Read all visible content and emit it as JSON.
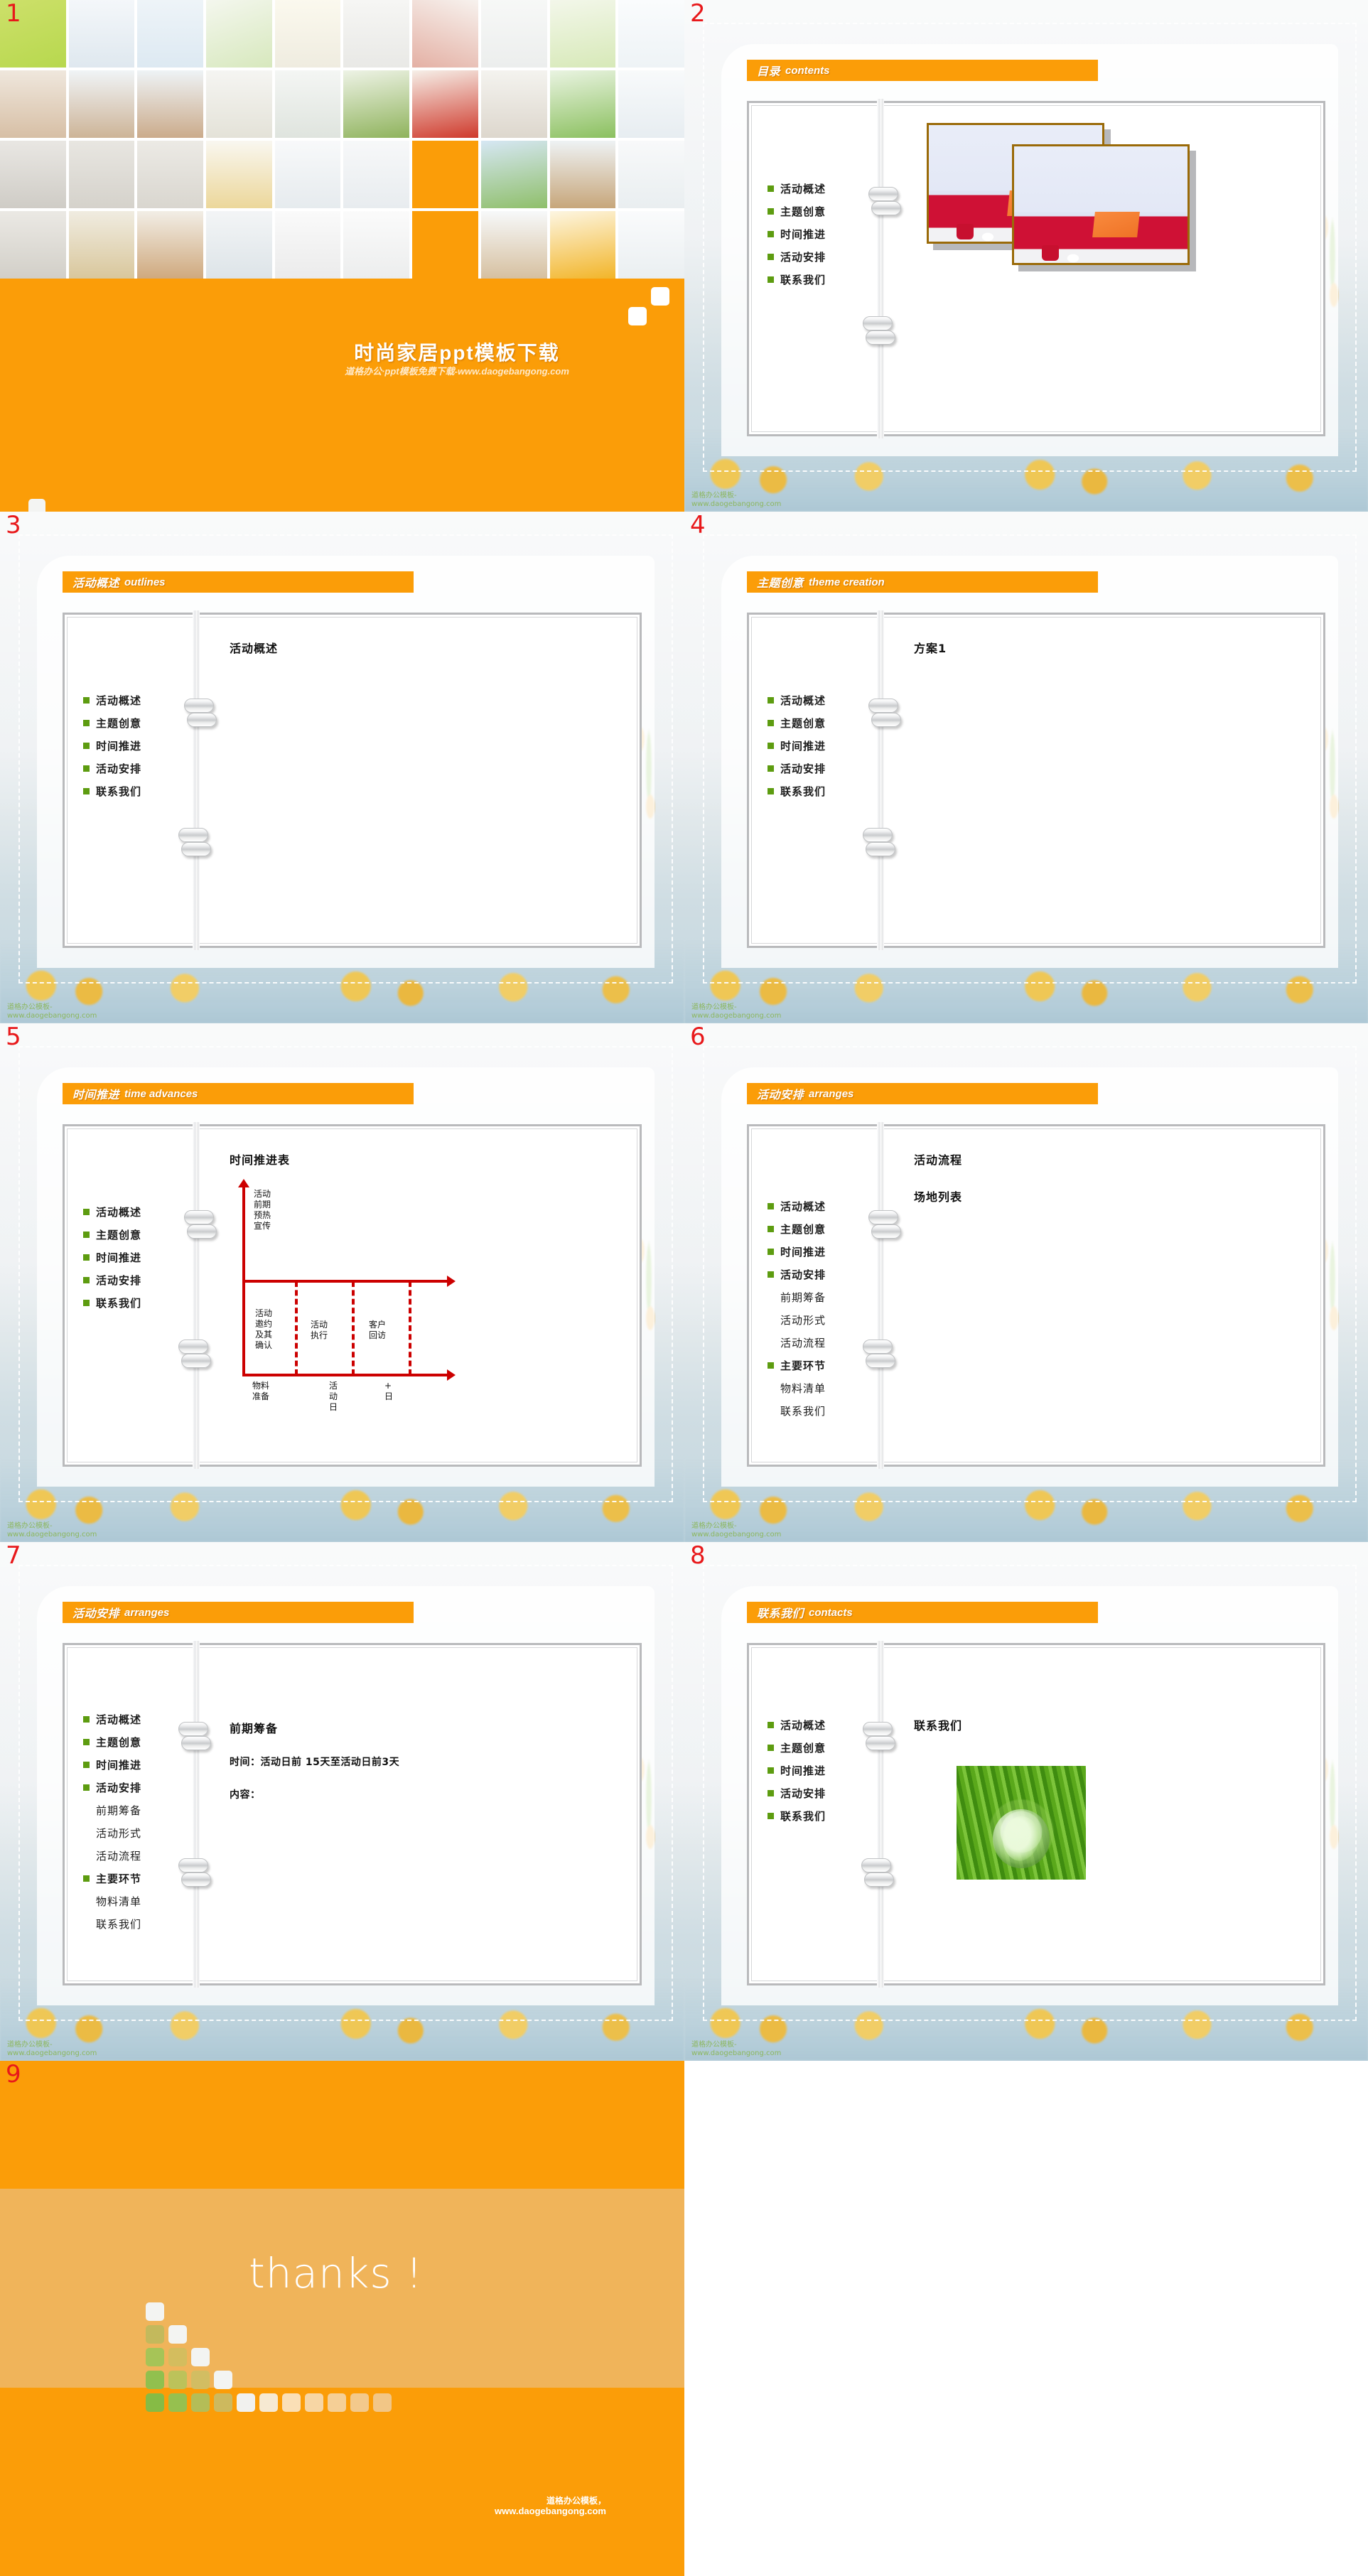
{
  "brand": {
    "orange": "#fb9d08",
    "orange_light": "#f0b45a",
    "green_bullet": "#5d9c10",
    "red_number": "#e8181a",
    "timeline_red": "#cc0000",
    "frame_gold": "#9a6a08"
  },
  "slide_numbers": [
    "1",
    "2",
    "3",
    "4",
    "5",
    "6",
    "7",
    "8",
    "9"
  ],
  "watermark": {
    "line1": "道格办公模板-",
    "line2": "www.daogebangong.com"
  },
  "cover": {
    "title": "时尚家居ppt模板下载",
    "subtitle": "道格办公·ppt模板免费下载-www.daogebangong.com"
  },
  "nav_default": [
    {
      "label": "活动概述",
      "bullet": true
    },
    {
      "label": "主题创意",
      "bullet": true
    },
    {
      "label": "时间推进",
      "bullet": true
    },
    {
      "label": "活动安排",
      "bullet": true
    },
    {
      "label": "联系我们",
      "bullet": true
    }
  ],
  "nav_expanded": [
    {
      "label": "活动概述",
      "bullet": true,
      "sub": false
    },
    {
      "label": "主题创意",
      "bullet": true,
      "sub": false
    },
    {
      "label": "时间推进",
      "bullet": true,
      "sub": false
    },
    {
      "label": "活动安排",
      "bullet": true,
      "sub": false
    },
    {
      "label": "前期筹备",
      "bullet": false,
      "sub": true
    },
    {
      "label": "活动形式",
      "bullet": false,
      "sub": true
    },
    {
      "label": "活动流程",
      "bullet": false,
      "sub": true
    },
    {
      "label": "主要环节",
      "bullet": true,
      "sub": false
    },
    {
      "label": "物料清单",
      "bullet": false,
      "sub": true
    },
    {
      "label": "联系我们",
      "bullet": false,
      "sub": true
    }
  ],
  "slides": {
    "s2": {
      "header_cn": "目录",
      "header_en": "contents"
    },
    "s3": {
      "header_cn": "活动概述",
      "header_en": "outlines",
      "body_title": "活动概述"
    },
    "s4": {
      "header_cn": "主题创意",
      "header_en": "theme creation",
      "body_title": "方案1"
    },
    "s5": {
      "header_cn": "时间推进",
      "header_en": "time advances",
      "body_title": "时间推进表"
    },
    "s6": {
      "header_cn": "活动安排",
      "header_en": "arranges",
      "body_title": "活动流程",
      "body_title2": "场地列表"
    },
    "s7": {
      "header_cn": "活动安排",
      "header_en": "arranges",
      "body_title": "前期筹备",
      "line_time": "时间：活动日前 15天至活动日前3天",
      "line_content": "内容："
    },
    "s8": {
      "header_cn": "联系我们",
      "header_en": "contacts",
      "body_title": "联系我们"
    },
    "s9": {
      "word": "thanks !",
      "foot1": "道格办公模板，",
      "foot2": "www.daogebangong.com"
    }
  },
  "chart_data": {
    "type": "timeline",
    "title": "时间推进表",
    "top_label": "活动\n前期\n预热\n宣传",
    "phases": [
      "活动邀约及其确认",
      "活动执行",
      "客户回访"
    ],
    "axis_labels": [
      "物料准备",
      "活动日",
      "+日"
    ],
    "dividers": 3
  }
}
